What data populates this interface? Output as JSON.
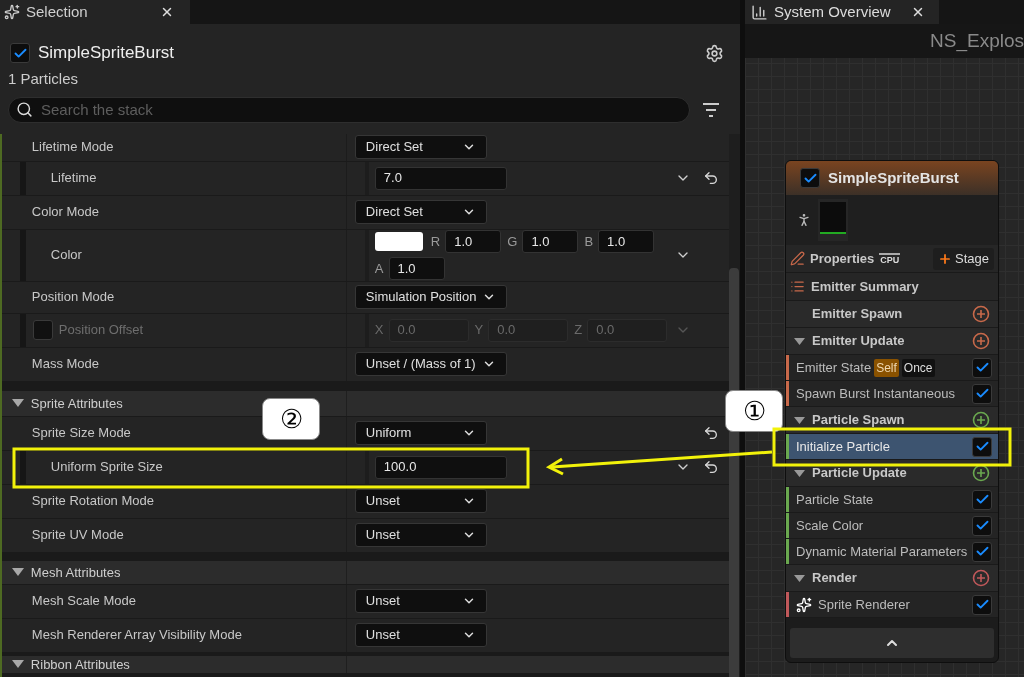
{
  "selection_tab": {
    "label": "Selection",
    "selected": true
  },
  "emitter": {
    "name": "SimpleSpriteBurst",
    "enabled": true,
    "subtitle": "1 Particles"
  },
  "search": {
    "placeholder": "Search the stack"
  },
  "stack": [
    {
      "kind": "dropdown",
      "label": "Lifetime Mode",
      "value": "Direct Set",
      "child": false,
      "chevron": false,
      "reset": false
    },
    {
      "kind": "number",
      "label": "Lifetime",
      "value": "7.0",
      "child": true,
      "chevron": true,
      "reset": true
    },
    {
      "kind": "dropdown",
      "label": "Color Mode",
      "value": "Direct Set",
      "child": false,
      "chevron": false,
      "reset": false
    },
    {
      "kind": "color",
      "label": "Color",
      "child": true,
      "chevron": true,
      "reset": false,
      "components": [
        {
          "axis": "R",
          "value": "1.0"
        },
        {
          "axis": "G",
          "value": "1.0"
        },
        {
          "axis": "B",
          "value": "1.0"
        },
        {
          "axis": "A",
          "value": "1.0"
        }
      ]
    },
    {
      "kind": "dropdown",
      "label": "Position Mode",
      "value": "Simulation Position",
      "child": false,
      "chevron": false,
      "reset": false
    },
    {
      "kind": "vector",
      "label": "Position Offset",
      "child": true,
      "disabled": true,
      "checked": false,
      "chevron": true,
      "reset": false,
      "components": [
        {
          "axis": "X",
          "value": "0.0"
        },
        {
          "axis": "Y",
          "value": "0.0"
        },
        {
          "axis": "Z",
          "value": "0.0"
        }
      ]
    },
    {
      "kind": "dropdown",
      "label": "Mass Mode",
      "value": "Unset / (Mass of 1)",
      "child": false,
      "chevron": false,
      "reset": false
    },
    {
      "kind": "section",
      "label": "Sprite Attributes",
      "expanded": true
    },
    {
      "kind": "dropdown",
      "label": "Sprite Size Mode",
      "value": "Uniform",
      "child": false,
      "chevron": false,
      "reset": true
    },
    {
      "kind": "number",
      "label": "Uniform Sprite Size",
      "value": "100.0",
      "child": true,
      "chevron": true,
      "reset": true
    },
    {
      "kind": "dropdown",
      "label": "Sprite Rotation Mode",
      "value": "Unset",
      "child": false,
      "chevron": false,
      "reset": false
    },
    {
      "kind": "dropdown",
      "label": "Sprite UV Mode",
      "value": "Unset",
      "child": false,
      "chevron": false,
      "reset": false
    },
    {
      "kind": "section",
      "label": "Mesh Attributes",
      "expanded": true
    },
    {
      "kind": "dropdown",
      "label": "Mesh Scale Mode",
      "value": "Unset",
      "child": false,
      "chevron": false,
      "reset": false
    },
    {
      "kind": "dropdown",
      "label": "Mesh Renderer Array Visibility Mode",
      "value": "Unset",
      "child": false,
      "chevron": false,
      "reset": false
    },
    {
      "kind": "section",
      "label": "Ribbon Attributes",
      "expanded": true
    }
  ],
  "overview": {
    "tab": {
      "label": "System Overview",
      "selected": true
    },
    "title": "NS_Explos",
    "node": {
      "name": "SimpleSpriteBurst",
      "enabled": true,
      "properties": "Properties",
      "sim_target": "CPU",
      "stage_button": "Stage",
      "summary": "Emitter Summary",
      "groups": [
        {
          "label": "Emitter Spawn",
          "color": "#c8694a",
          "expandable": false
        },
        {
          "label": "Emitter Update",
          "color": "#c8694a",
          "expandable": true,
          "items": [
            {
              "label": "Emitter State",
              "checked": true,
              "selected": false,
              "badges": [
                {
                  "label": "Self",
                  "kind": "highlight"
                },
                {
                  "label": "Once",
                  "kind": "plain"
                }
              ]
            },
            {
              "label": "Spawn Burst Instantaneous",
              "checked": true,
              "selected": false
            }
          ]
        },
        {
          "label": "Particle Spawn",
          "color": "#6aa84f",
          "expandable": true,
          "items": [
            {
              "label": "Initialize Particle",
              "checked": true,
              "selected": true
            }
          ]
        },
        {
          "label": "Particle Update",
          "color": "#6aa84f",
          "expandable": true,
          "items": [
            {
              "label": "Particle State",
              "checked": true,
              "selected": false
            },
            {
              "label": "Scale Color",
              "checked": true,
              "selected": false
            },
            {
              "label": "Dynamic Material Parameters",
              "checked": true,
              "selected": false
            }
          ]
        },
        {
          "label": "Render",
          "color": "#c0585a",
          "expandable": true,
          "items": [
            {
              "label": "Sprite Renderer",
              "checked": true,
              "selected": false,
              "kind": "renderer"
            }
          ]
        }
      ]
    }
  },
  "annotations": [
    {
      "label": "②"
    },
    {
      "label": "①"
    }
  ]
}
